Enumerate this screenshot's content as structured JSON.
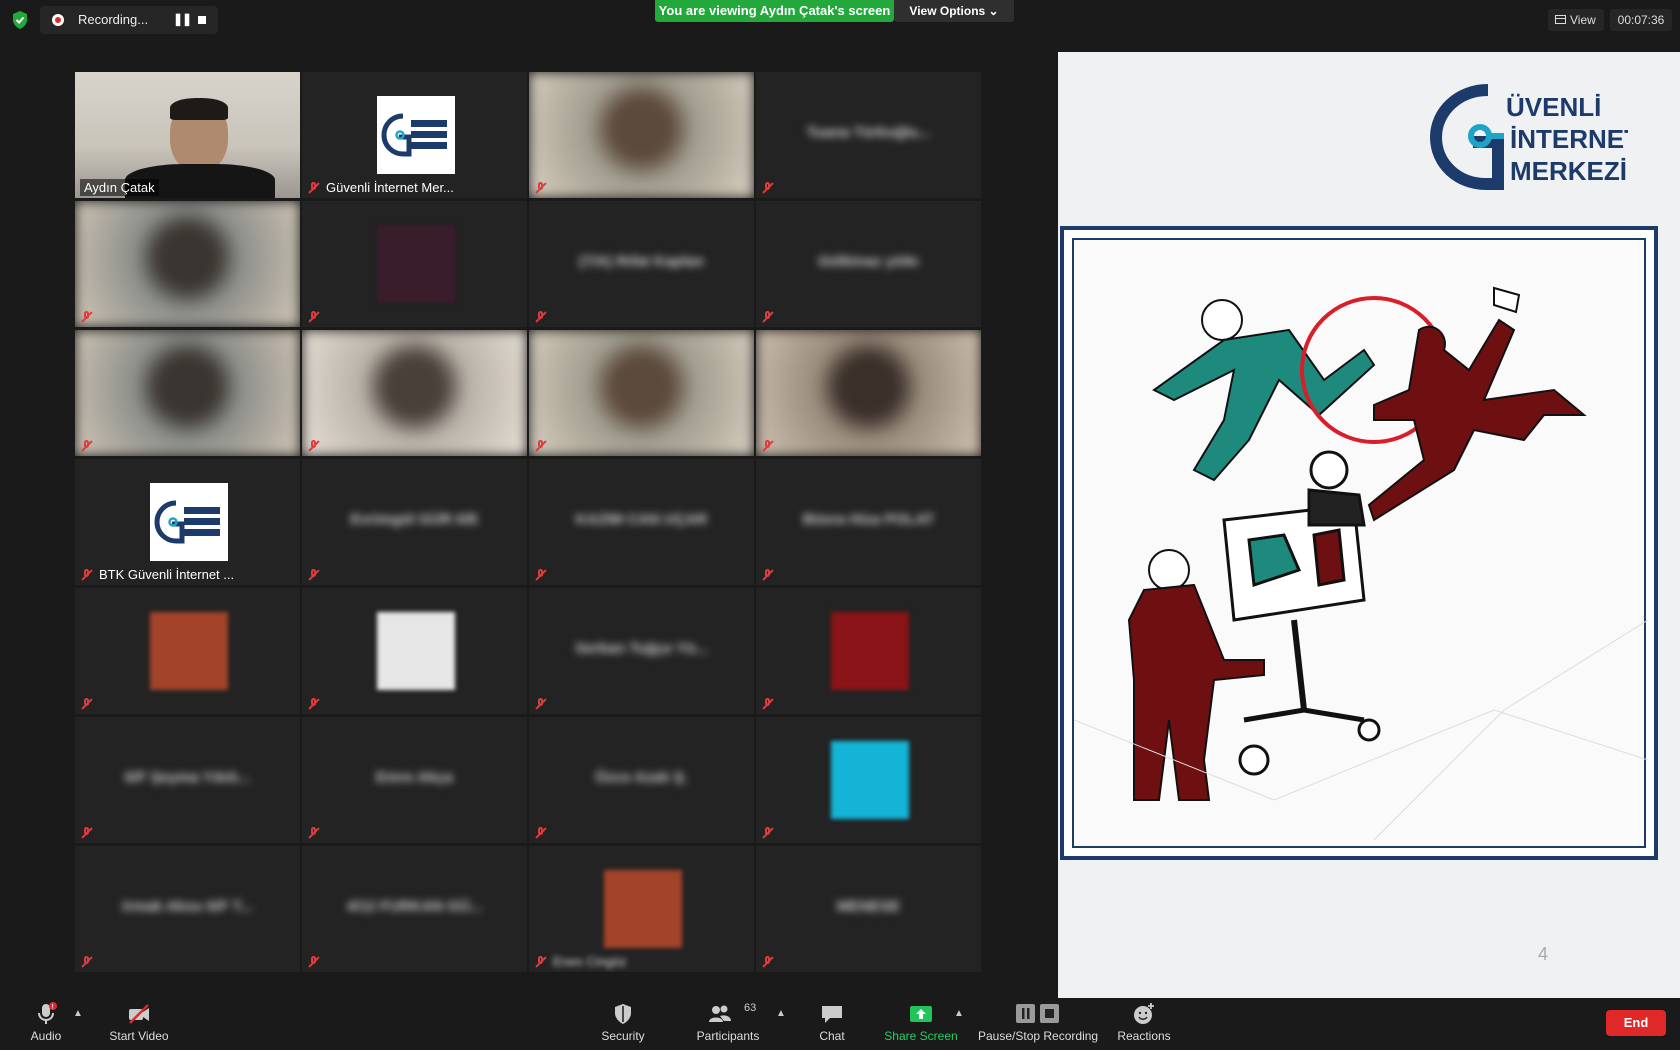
{
  "topbar": {
    "recording_label": "Recording...",
    "viewing_banner": "You are viewing Aydın Çatak's screen",
    "view_options": "View Options ⌄",
    "view_label": "View",
    "timer": "00:07:36"
  },
  "gallery": {
    "tiles": [
      {
        "name": "Aydın Çatak",
        "kind": "camera",
        "active": true
      },
      {
        "name": "Güvenli İnternet Mer...",
        "kind": "logo"
      },
      {
        "name": "",
        "kind": "camera-blurred"
      },
      {
        "name": "Tuana Türkoğlu...",
        "kind": "name-only"
      },
      {
        "name": "",
        "kind": "camera-blurred"
      },
      {
        "name": "",
        "kind": "image-blurred"
      },
      {
        "name": "(7/A) Rıfat Kaplan",
        "kind": "name-only"
      },
      {
        "name": "Gülbinaz yılıkı",
        "kind": "name-only"
      },
      {
        "name": "",
        "kind": "camera-blurred"
      },
      {
        "name": "",
        "kind": "camera-blurred"
      },
      {
        "name": "",
        "kind": "camera-blurred"
      },
      {
        "name": "",
        "kind": "camera-blurred"
      },
      {
        "name": "BTK Güvenli İnternet ...",
        "kind": "logo"
      },
      {
        "name": "Evrimgül GÜR 6/E",
        "kind": "name-only"
      },
      {
        "name": "KAZIM CAN UÇAR",
        "kind": "name-only"
      },
      {
        "name": "Büsra Hiza POLAT",
        "kind": "name-only"
      },
      {
        "name": "",
        "kind": "image-blurred"
      },
      {
        "name": "",
        "kind": "image-blurred"
      },
      {
        "name": "Serkan Tuğçe Yü...",
        "kind": "name-only"
      },
      {
        "name": "",
        "kind": "image-blurred"
      },
      {
        "name": "6/F Şeyma Yıkılı...",
        "kind": "name-only"
      },
      {
        "name": "Emre Akça",
        "kind": "name-only"
      },
      {
        "name": "Özce Azalı Ş.",
        "kind": "name-only"
      },
      {
        "name": "",
        "kind": "image-blurred"
      },
      {
        "name": "Irmak Aksu 6/F T...",
        "kind": "name-only"
      },
      {
        "name": "4/12 FURKAN GÜ...",
        "kind": "name-only"
      },
      {
        "name": "Enes Cingöz",
        "kind": "image-blurred"
      },
      {
        "name": "MENESE",
        "kind": "name-only"
      }
    ]
  },
  "slide": {
    "logo_line1": "ÜVENLİ",
    "logo_line2": "İNTERNET",
    "logo_line3": "MERKEZİ",
    "page_number": "4"
  },
  "toolbar": {
    "audio": "Audio",
    "start_video": "Start Video",
    "security": "Security",
    "participants": "Participants",
    "participants_count": "63",
    "chat": "Chat",
    "share_screen": "Share Screen",
    "pause_stop_recording": "Pause/Stop Recording",
    "reactions": "Reactions",
    "end": "End"
  },
  "colors": {
    "active_border": "#c8de6a",
    "banner_green": "#23a83b",
    "end_red": "#e02828",
    "slide_navy": "#1d3b6a"
  }
}
